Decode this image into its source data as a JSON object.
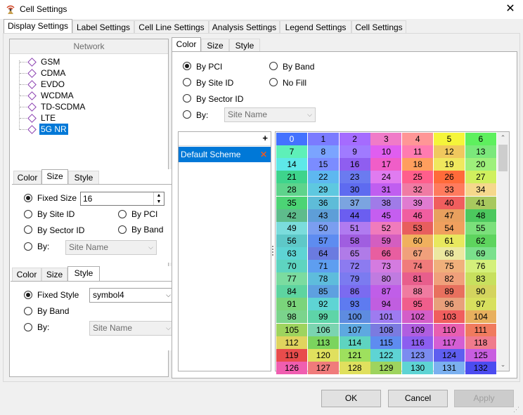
{
  "window": {
    "title": "Cell Settings",
    "close_glyph": "✕"
  },
  "main_tabs": [
    "Display Settings",
    "Label Settings",
    "Cell Line Settings",
    "Analysis Settings",
    "Legend Settings",
    "Cell Settings"
  ],
  "network": {
    "header": "Network",
    "items": [
      "GSM",
      "CDMA",
      "EVDO",
      "WCDMA",
      "TD-SCDMA",
      "LTE",
      "5G NR"
    ],
    "selected": "5G NR"
  },
  "right_tabs": [
    "Color",
    "Size",
    "Style"
  ],
  "color_options": {
    "by_pci": "By PCI",
    "by_band": "By Band",
    "by_site_id": "By Site ID",
    "no_fill": "No Fill",
    "by_sector_id": "By Sector ID",
    "by": "By:",
    "by_combo": "Site Name",
    "selected": "By PCI"
  },
  "scheme": {
    "add_glyph": "+",
    "items": [
      "Default Scheme"
    ],
    "delete_glyph": "✕"
  },
  "size_panel": {
    "tabs": [
      "Color",
      "Size",
      "Style"
    ],
    "fixed_size": "Fixed Size",
    "fixed_value": "16",
    "by_site_id": "By Site ID",
    "by_pci": "By PCI",
    "by_sector_id": "By Sector ID",
    "by_band": "By Band",
    "by": "By:",
    "by_combo": "Site Name"
  },
  "style_panel": {
    "tabs": [
      "Color",
      "Size",
      "Style"
    ],
    "fixed_style": "Fixed Style",
    "style_value": "symbol4",
    "by_band": "By Band",
    "by": "By:",
    "by_combo": "Site Name"
  },
  "buttons": {
    "ok": "OK",
    "cancel": "Cancel",
    "apply": "Apply"
  },
  "palette": {
    "colors": [
      "#4472ff",
      "#7b7bff",
      "#a56bff",
      "#f07bc8",
      "#ff9696",
      "#f5f53a",
      "#5ef05e",
      "#5ef0b8",
      "#7ba4ff",
      "#a07bff",
      "#e05ef0",
      "#ff7bb0",
      "#f0c85e",
      "#7be87b",
      "#5ee8e8",
      "#7b8cff",
      "#8f5ef0",
      "#f05ec8",
      "#ff9e5e",
      "#f0e85e",
      "#9ef07b",
      "#3ed48c",
      "#5eb8f0",
      "#6b7bf0",
      "#e07bf0",
      "#ff5e8c",
      "#ff6b3a",
      "#d0f05e",
      "#5ed48c",
      "#5ec8e0",
      "#5e6bf0",
      "#c05ef0",
      "#f07ba4",
      "#ff7b5e",
      "#f5d88c",
      "#4cd475",
      "#5ebcd8",
      "#7ba4e0",
      "#a07be8",
      "#e07bd0",
      "#f05e5e",
      "#a8c85e",
      "#5ebc8c",
      "#5e9ed8",
      "#6b5ef0",
      "#c55ef0",
      "#f05ea0",
      "#e8a05e",
      "#4cc85e",
      "#7bdcdc",
      "#7b9ef0",
      "#b07bf0",
      "#f07bbc",
      "#e85e5e",
      "#f0a05e",
      "#7be07b",
      "#5ec8c8",
      "#5e8cf0",
      "#a05ee0",
      "#d45ec0",
      "#f0b05e",
      "#e8e85e",
      "#5ed45e",
      "#5ed4d4",
      "#6b7be0",
      "#b07be8",
      "#e85ea0",
      "#f0a07b",
      "#ece8a0",
      "#7be08c",
      "#5ed4c0",
      "#5e9ef0",
      "#8c7bf0",
      "#d47be0",
      "#f07b7b",
      "#f0b07b",
      "#d4f07b",
      "#7bdca0",
      "#5ebcdc",
      "#7b7bf0",
      "#c07be0",
      "#e85e8c",
      "#f0a07b",
      "#c8e05e",
      "#5ed4a0",
      "#5ea0e0",
      "#7b6bf0",
      "#c05ee8",
      "#f07ba0",
      "#e8705e",
      "#d4d45e",
      "#7bd47b",
      "#5ed4d4",
      "#5e7bf0",
      "#c05ee0",
      "#f05e8c",
      "#e8a07b",
      "#d8e05e",
      "#7bd48c",
      "#5ed4a8",
      "#5e8ce0",
      "#9e7bf0",
      "#d45ec8",
      "#f05e5e",
      "#e8b05e",
      "#9ed45e",
      "#7bd4b0",
      "#5ea8e0",
      "#7b7be0",
      "#b05ee0",
      "#e85eb0",
      "#f07b5e",
      "#e0d45e",
      "#7bd45e",
      "#5ed4c0",
      "#5e8cf0",
      "#8c5ef0",
      "#d45ed4",
      "#f07b8c",
      "#e84c4c",
      "#e0e05e",
      "#9ee05e",
      "#5ed4d4",
      "#7b8cf0",
      "#5e5ef0",
      "#c85ee0",
      "#f05eb0",
      "#f07b7b",
      "#e0e05e",
      "#9ed45e",
      "#5ed4d4",
      "#7bb0f0",
      "#4c4cf0",
      "#e05ee0"
    ]
  },
  "pci_values_start": 0,
  "pci_values_end": 132
}
